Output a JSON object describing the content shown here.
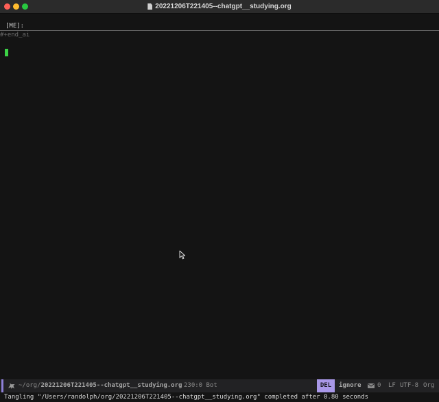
{
  "window": {
    "title": "20221206T221405--chatgpt__studying.org",
    "traffic_lights": {
      "close_color": "#fe5f57",
      "minimize_color": "#febc2e",
      "zoom_color": "#28c840"
    }
  },
  "editor": {
    "header_label": "[ME]:",
    "end_line": "#+end_ai",
    "cursor_color": "#3cd246"
  },
  "modeline": {
    "icon": "org-unicorn-icon",
    "path_prefix": "~/org/",
    "file": "20221206T221405--chatgpt__studying.org",
    "position": "230:0",
    "scroll": "Bot",
    "mode": "DEL",
    "ignore": "ignore",
    "mail_icon": "envelope-icon",
    "mail_count": "0",
    "eol": "LF",
    "encoding": "UTF-8",
    "major_mode": "Org",
    "accent_color": "#a998e8"
  },
  "echo": {
    "message": "Tangling \"/Users/randolph/org/20221206T221405--chatgpt__studying.org\" completed after 0.80 seconds"
  }
}
